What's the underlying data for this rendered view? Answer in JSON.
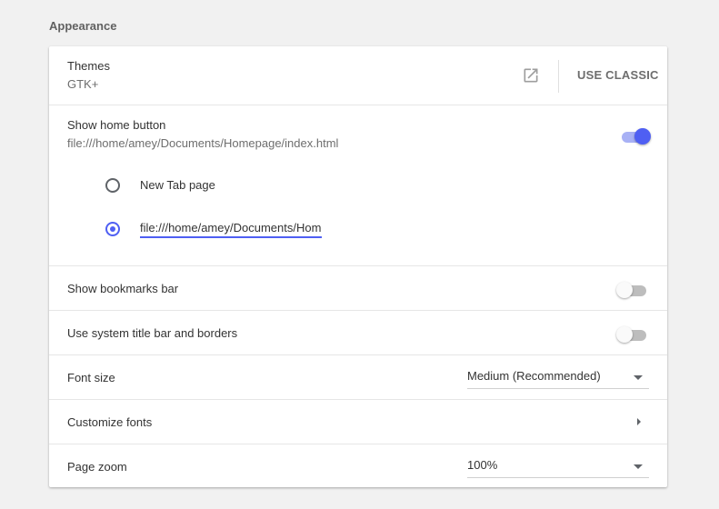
{
  "section": {
    "title": "Appearance"
  },
  "themes": {
    "label": "Themes",
    "value": "GTK+",
    "use_classic_label": "USE CLASSIC",
    "external_link_icon": "open-in-new-icon"
  },
  "home_button": {
    "label": "Show home button",
    "value": "file:///home/amey/Documents/Homepage/index.html",
    "enabled": true,
    "options": [
      {
        "label": "New Tab page",
        "checked": false
      },
      {
        "label": "",
        "checked": true,
        "input_value": "file:///home/amey/Documents/Homepage/index.html"
      }
    ]
  },
  "bookmarks_bar": {
    "label": "Show bookmarks bar",
    "enabled": false
  },
  "system_title_bar": {
    "label": "Use system title bar and borders",
    "enabled": false
  },
  "font_size": {
    "label": "Font size",
    "selected": "Medium (Recommended)"
  },
  "customize_fonts": {
    "label": "Customize fonts"
  },
  "page_zoom": {
    "label": "Page zoom",
    "selected": "100%"
  },
  "colors": {
    "accent": "#4f5ff3",
    "accent_light": "#a8b1f5"
  }
}
